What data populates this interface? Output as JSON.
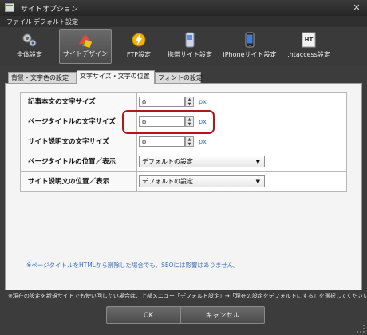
{
  "window": {
    "title": "サイトオプション",
    "close_glyph": "✕"
  },
  "menu": [
    "ファイル",
    "デフォルト設定"
  ],
  "toolbar": [
    {
      "label": "全体設定",
      "icon": "gears-icon"
    },
    {
      "label": "サイトデザイン",
      "icon": "palette-icon",
      "active": true
    },
    {
      "label": "FTP設定",
      "icon": "ftp-bolt-icon"
    },
    {
      "label": "携帯サイト設定",
      "icon": "mobile-phone-icon"
    },
    {
      "label": "iPhoneサイト設定",
      "icon": "iphone-icon"
    },
    {
      "label": ".htaccess設定",
      "icon": "htaccess-icon",
      "icon_text": "HT"
    }
  ],
  "tabs": [
    {
      "label": "背景・文字色の設定"
    },
    {
      "label": "文字サイズ・文字の位置",
      "active": true
    },
    {
      "label": "フォントの設定"
    }
  ],
  "rows": [
    {
      "label": "記事本文の文字サイズ",
      "value": "0",
      "unit": "px"
    },
    {
      "label": "ページタイトルの文字サイズ",
      "value": "0",
      "unit": "px"
    },
    {
      "label": "サイト説明文の文字サイズ",
      "value": "0",
      "unit": "px"
    },
    {
      "label": "ページタイトルの位置／表示",
      "selected": "デフォルトの設定"
    },
    {
      "label": "サイト説明文の位置／表示",
      "selected": "デフォルトの設定"
    }
  ],
  "note": "※ページタイトルをHTMLから削除した場合でも、SEOには影響はありません。",
  "footer_note": "※現在の設定を新規サイトでも使い回したい場合は、上部メニュー「デフォルト設定」→「現在の設定をデフォルトにする」を選択してください。",
  "buttons": {
    "ok": "OK",
    "cancel": "キャンセル"
  },
  "colors": {
    "highlight": "#b0161c",
    "link": "#3a6fb8"
  }
}
